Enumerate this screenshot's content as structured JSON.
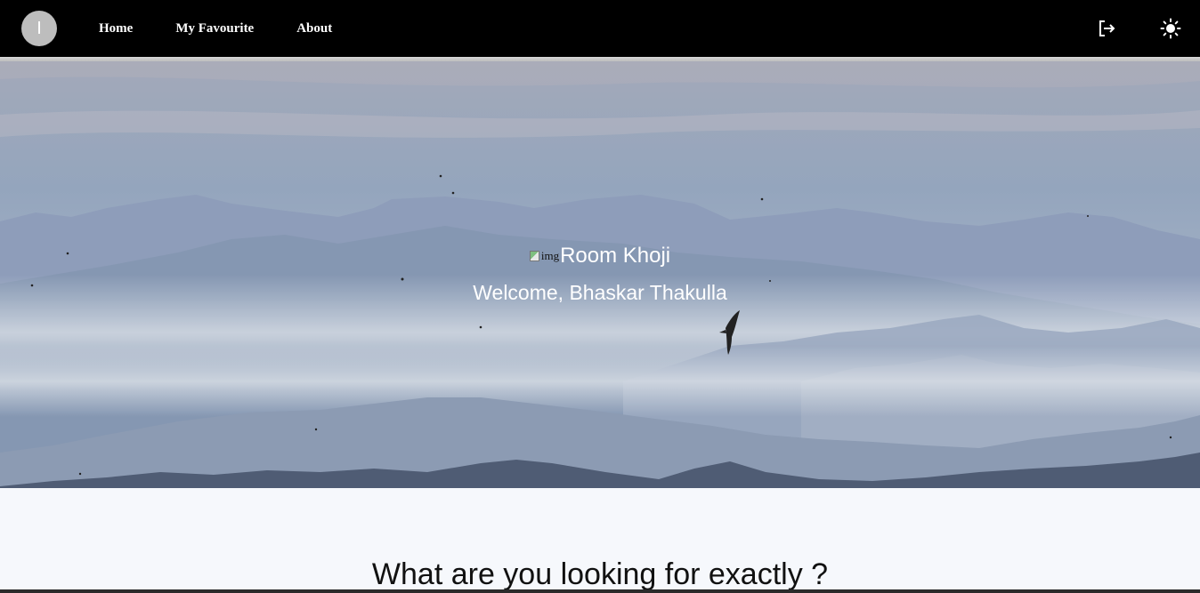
{
  "navbar": {
    "avatar_initial": "I",
    "links": [
      {
        "label": "Home"
      },
      {
        "label": "My Favourite"
      },
      {
        "label": "About"
      }
    ],
    "logout_icon": "logout-icon",
    "theme_icon": "sun-icon"
  },
  "hero": {
    "logo_alt": "img",
    "brand_name": "Room Khoji",
    "welcome_text": "Welcome, Bhaskar Thakulla"
  },
  "main": {
    "section_title": "What are you looking for exactly ?"
  },
  "colors": {
    "navbar_bg": "#000000",
    "page_bg": "#f6f8fc",
    "avatar_bg": "#bdbdbd"
  }
}
